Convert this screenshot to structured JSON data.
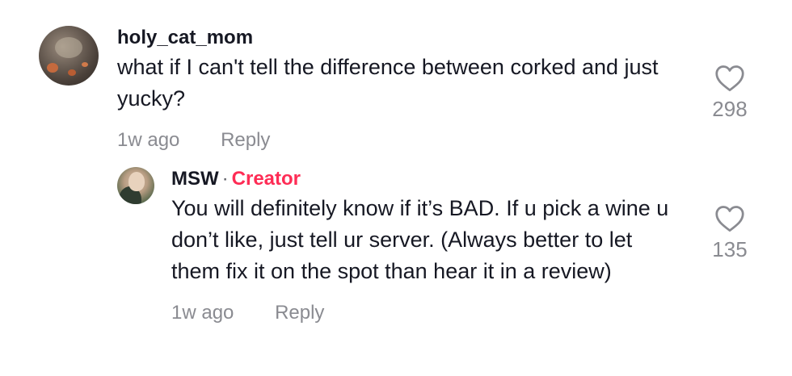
{
  "comments": [
    {
      "username": "holy_cat_mom",
      "text": "what if I can't tell the difference between corked and just yucky?",
      "time": "1w ago",
      "reply_label": "Reply",
      "likes": "298"
    }
  ],
  "reply": {
    "username": "MSW",
    "separator": "·",
    "badge": "Creator",
    "text": "You will definitely know if it’s BAD. If u pick a wine u don’t like, just tell ur server. (Always better to let them fix it on the spot than hear it in a review)",
    "time": "1w ago",
    "reply_label": "Reply",
    "likes": "135"
  },
  "icons": {
    "like": "heart-outline-icon"
  },
  "colors": {
    "creator_badge": "#fe2c55",
    "meta_text": "#8a8b91",
    "primary_text": "#161823"
  }
}
